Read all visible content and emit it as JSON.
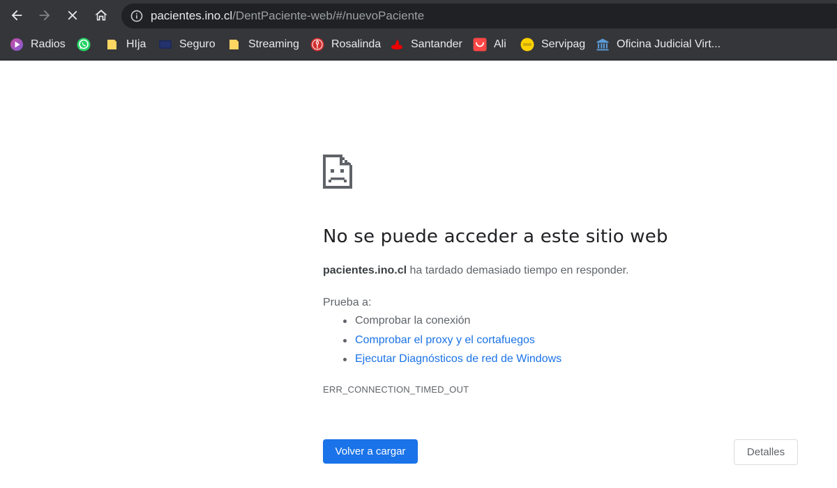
{
  "browser": {
    "address_bar": {
      "host": "pacientes.ino.cl",
      "path": "/DentPaciente-web/#/nuevoPaciente"
    },
    "nav": {
      "back_icon": "arrow-left-icon",
      "forward_icon": "arrow-right-icon",
      "stop_icon": "close-icon",
      "home_icon": "home-icon",
      "info_icon": "info-icon"
    },
    "bookmarks": [
      {
        "label": "Radios",
        "icon": "radio-icon"
      },
      {
        "label": "",
        "icon": "whatsapp-icon"
      },
      {
        "label": "HIja",
        "icon": "folder-icon"
      },
      {
        "label": "Seguro",
        "icon": "seguro-icon"
      },
      {
        "label": "Streaming",
        "icon": "folder-icon"
      },
      {
        "label": "Rosalinda",
        "icon": "rosalinda-icon"
      },
      {
        "label": "Santander",
        "icon": "santander-icon"
      },
      {
        "label": "Ali",
        "icon": "aliexpress-icon"
      },
      {
        "label": "Servipag",
        "icon": "servipag-icon"
      },
      {
        "label": "Oficina Judicial Virt...",
        "icon": "bank-icon"
      }
    ]
  },
  "error_page": {
    "icon": "sad-document-icon",
    "title": "No se puede acceder a este sitio web",
    "host": "pacientes.ino.cl",
    "description": " ha tardado demasiado tiempo en responder.",
    "try_label": "Prueba a:",
    "suggestions": [
      "Comprobar la conexión",
      "Comprobar el proxy y el cortafuegos",
      "Ejecutar Diagnósticos de red de Windows"
    ],
    "error_code": "ERR_CONNECTION_TIMED_OUT",
    "reload_label": "Volver a cargar",
    "details_label": "Detalles"
  },
  "colors": {
    "toolbar_bg": "#35363a",
    "omnibox_bg": "#202124",
    "primary_button": "#1a73e8",
    "link": "#1a73e8"
  }
}
